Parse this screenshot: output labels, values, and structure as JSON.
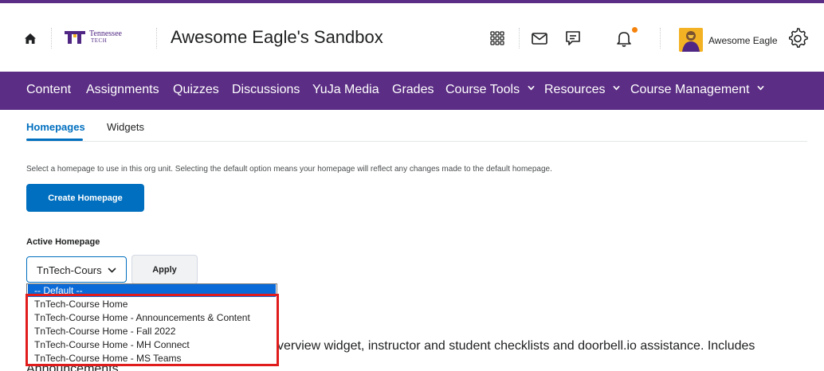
{
  "header": {
    "logo_line1": "Tennessee",
    "logo_line2": "TECH",
    "course_title": "Awesome Eagle's Sandbox",
    "user_name": "Awesome Eagle"
  },
  "nav": {
    "items": [
      {
        "label": "Content"
      },
      {
        "label": "Assignments"
      },
      {
        "label": "Quizzes"
      },
      {
        "label": "Discussions"
      },
      {
        "label": "YuJa Media"
      },
      {
        "label": "Grades"
      },
      {
        "label": "Course Tools"
      },
      {
        "label": "Resources"
      },
      {
        "label": "Course Management"
      }
    ]
  },
  "tabs": [
    {
      "label": "Homepages",
      "active": true
    },
    {
      "label": "Widgets",
      "active": false
    }
  ],
  "main": {
    "description": "Select a homepage to use in this org unit. Selecting the default option means your homepage will reflect any changes made to the default homepage.",
    "create_button": "Create Homepage",
    "active_homepage_label": "Active Homepage",
    "select_value": "TnTech-Course Home",
    "apply_button": "Apply",
    "dropdown_options": [
      "-- Default --",
      "TnTech-Course Home",
      "TnTech-Course Home - Announcements & Content",
      "TnTech-Course Home - Fall 2022",
      "TnTech-Course Home - MH Connect",
      "TnTech-Course Home - MS Teams"
    ],
    "background_text": "verview widget, instructor and student checklists and doorbell.io assistance.  Includes",
    "background_text2": "Announcements"
  },
  "colors": {
    "brand_purple": "#5b2d84",
    "primary_blue": "#006fbf",
    "highlight_red": "#e01c1c",
    "notification_orange": "#f5820b"
  },
  "icons": [
    "home-icon",
    "tennessee-tech-logo",
    "waffle-grid-icon",
    "mail-icon",
    "chat-icon",
    "bell-icon",
    "avatar",
    "gear-icon",
    "chevron-down-icon"
  ]
}
